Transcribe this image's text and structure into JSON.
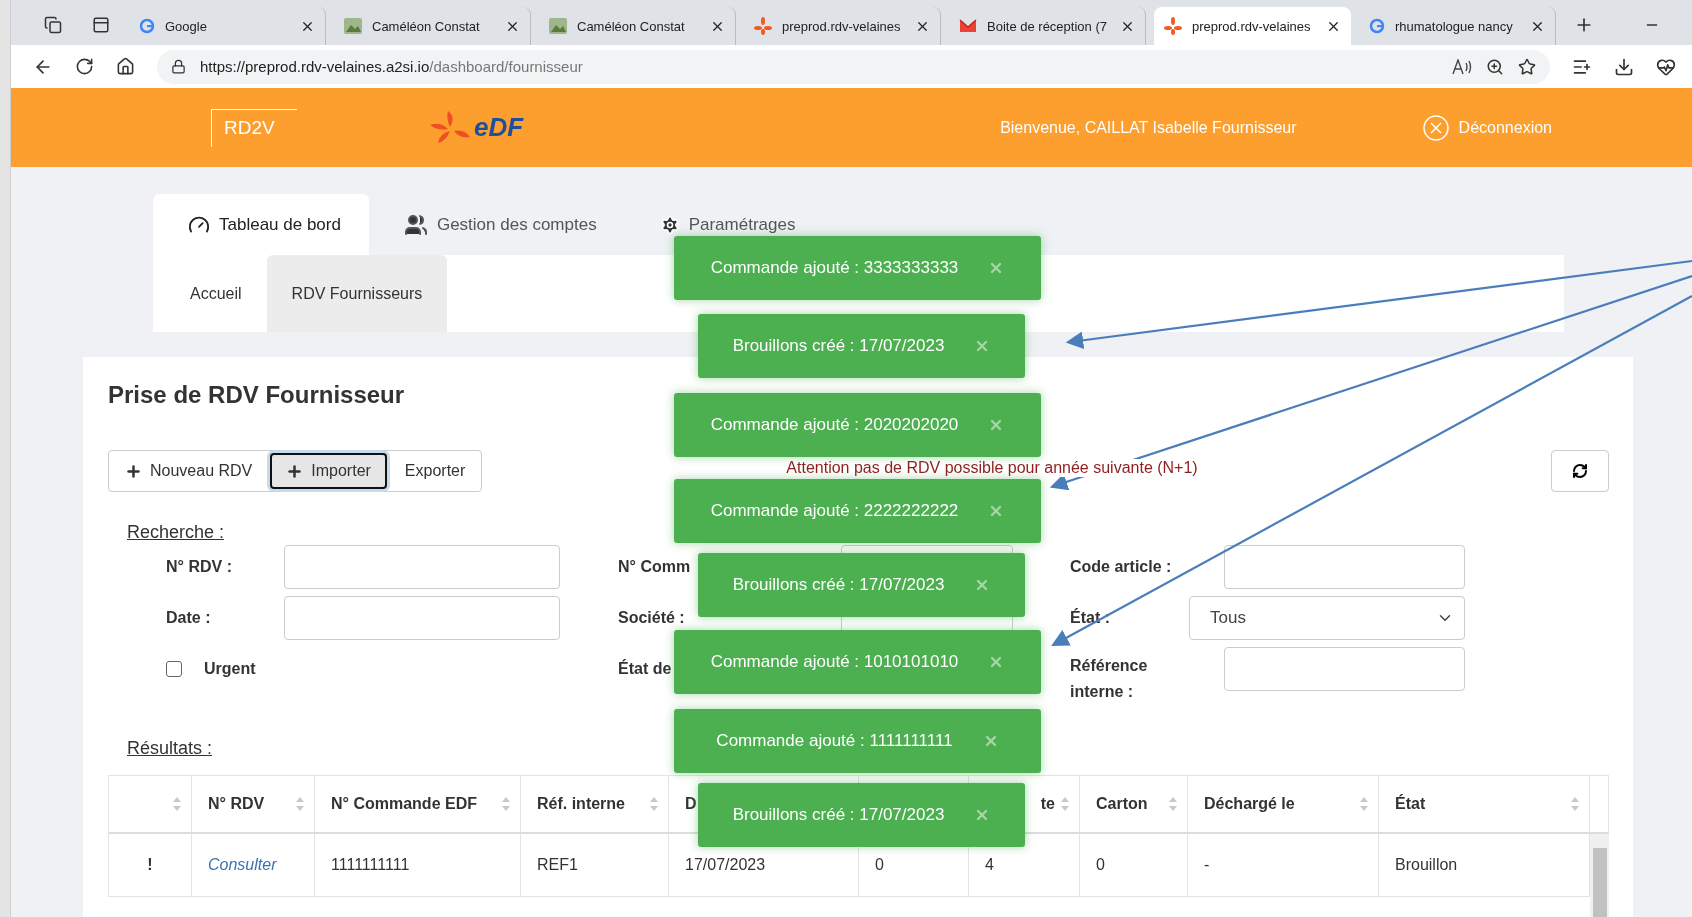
{
  "browser": {
    "tabs": [
      {
        "title": "Google",
        "selected": false
      },
      {
        "title": "Caméléon Constat",
        "selected": false
      },
      {
        "title": "Caméléon Constat",
        "selected": false
      },
      {
        "title": "preprod.rdv-velaines",
        "selected": false
      },
      {
        "title": "Boite de réception (7",
        "selected": false
      },
      {
        "title": "preprod.rdv-velaines",
        "selected": true
      },
      {
        "title": "rhumatologue nancy",
        "selected": false
      }
    ],
    "url_host": "https://preprod.rdv-velaines.a2si.io",
    "url_path": "/dashboard/fournisseur"
  },
  "header": {
    "logo": "RD2V",
    "brand": "eDF",
    "welcome": "Bienvenue, CAILLAT Isabelle Fournisseur",
    "logout": "Déconnexion"
  },
  "main_tabs": [
    {
      "label": "Tableau de bord",
      "selected": true
    },
    {
      "label": "Gestion des comptes",
      "selected": false
    },
    {
      "label": "Paramétrages",
      "selected": false
    }
  ],
  "sub_tabs": [
    {
      "label": "Accueil",
      "selected": false
    },
    {
      "label": "RDV Fournisseurs",
      "selected": true
    }
  ],
  "page_title": "Prise de RDV Fournisseur",
  "actions": [
    {
      "label": "Nouveau RDV",
      "plus": true,
      "focused": false
    },
    {
      "label": "Importer",
      "plus": true,
      "focused": true
    },
    {
      "label": "Exporter",
      "plus": false,
      "focused": false
    }
  ],
  "warning": "Attention pas de RDV possible pour année suivante (N+1)",
  "search": {
    "heading": "Recherche :",
    "fields": [
      {
        "label": "N° RDV :",
        "kind": "text"
      },
      {
        "label": "N° Comm",
        "kind": "text"
      },
      {
        "label": "Code article :",
        "kind": "text"
      },
      {
        "label": "Date :",
        "kind": "text"
      },
      {
        "label": "Société :",
        "kind": "text"
      },
      {
        "label": "État :",
        "kind": "select",
        "value": "Tous"
      },
      {
        "label": "Urgent",
        "kind": "checkbox",
        "checked": false
      },
      {
        "label": "État de",
        "kind": "label"
      },
      {
        "label": "Référence interne :",
        "kind": "text"
      }
    ]
  },
  "results": {
    "heading": "Résultats :",
    "columns": [
      {
        "sortable": true
      },
      {
        "label": "N° RDV",
        "sortable": true
      },
      {
        "label": "N° Commande EDF",
        "sortable": true
      },
      {
        "label": "Réf. interne",
        "sortable": true
      },
      {
        "label": "D"
      },
      {},
      {
        "label": "te",
        "sortable": true
      },
      {
        "label": "Carton",
        "sortable": true
      },
      {
        "label": "Déchargé le",
        "sortable": true
      },
      {
        "label": "État",
        "sortable": true
      }
    ],
    "rows": [
      {
        "cells": [
          "!",
          "Consulter",
          "1111111111",
          "REF1",
          "17/07/2023",
          "0",
          "4",
          "0",
          "-",
          "Brouillon"
        ]
      }
    ]
  },
  "toasts": [
    {
      "kind": "order",
      "text": "Commande ajouté : 3333333333"
    },
    {
      "kind": "draft",
      "text": "Brouillons créé : 17/07/2023"
    },
    {
      "kind": "order",
      "text": "Commande ajouté : 2020202020"
    },
    {
      "kind": "order",
      "text": "Commande ajouté : 2222222222"
    },
    {
      "kind": "draft",
      "text": "Brouillons créé : 17/07/2023"
    },
    {
      "kind": "order",
      "text": "Commande ajouté : 1010101010"
    },
    {
      "kind": "order",
      "text": "Commande ajouté : 1111111111"
    },
    {
      "kind": "draft",
      "text": "Brouillons créé : 17/07/2023"
    }
  ]
}
